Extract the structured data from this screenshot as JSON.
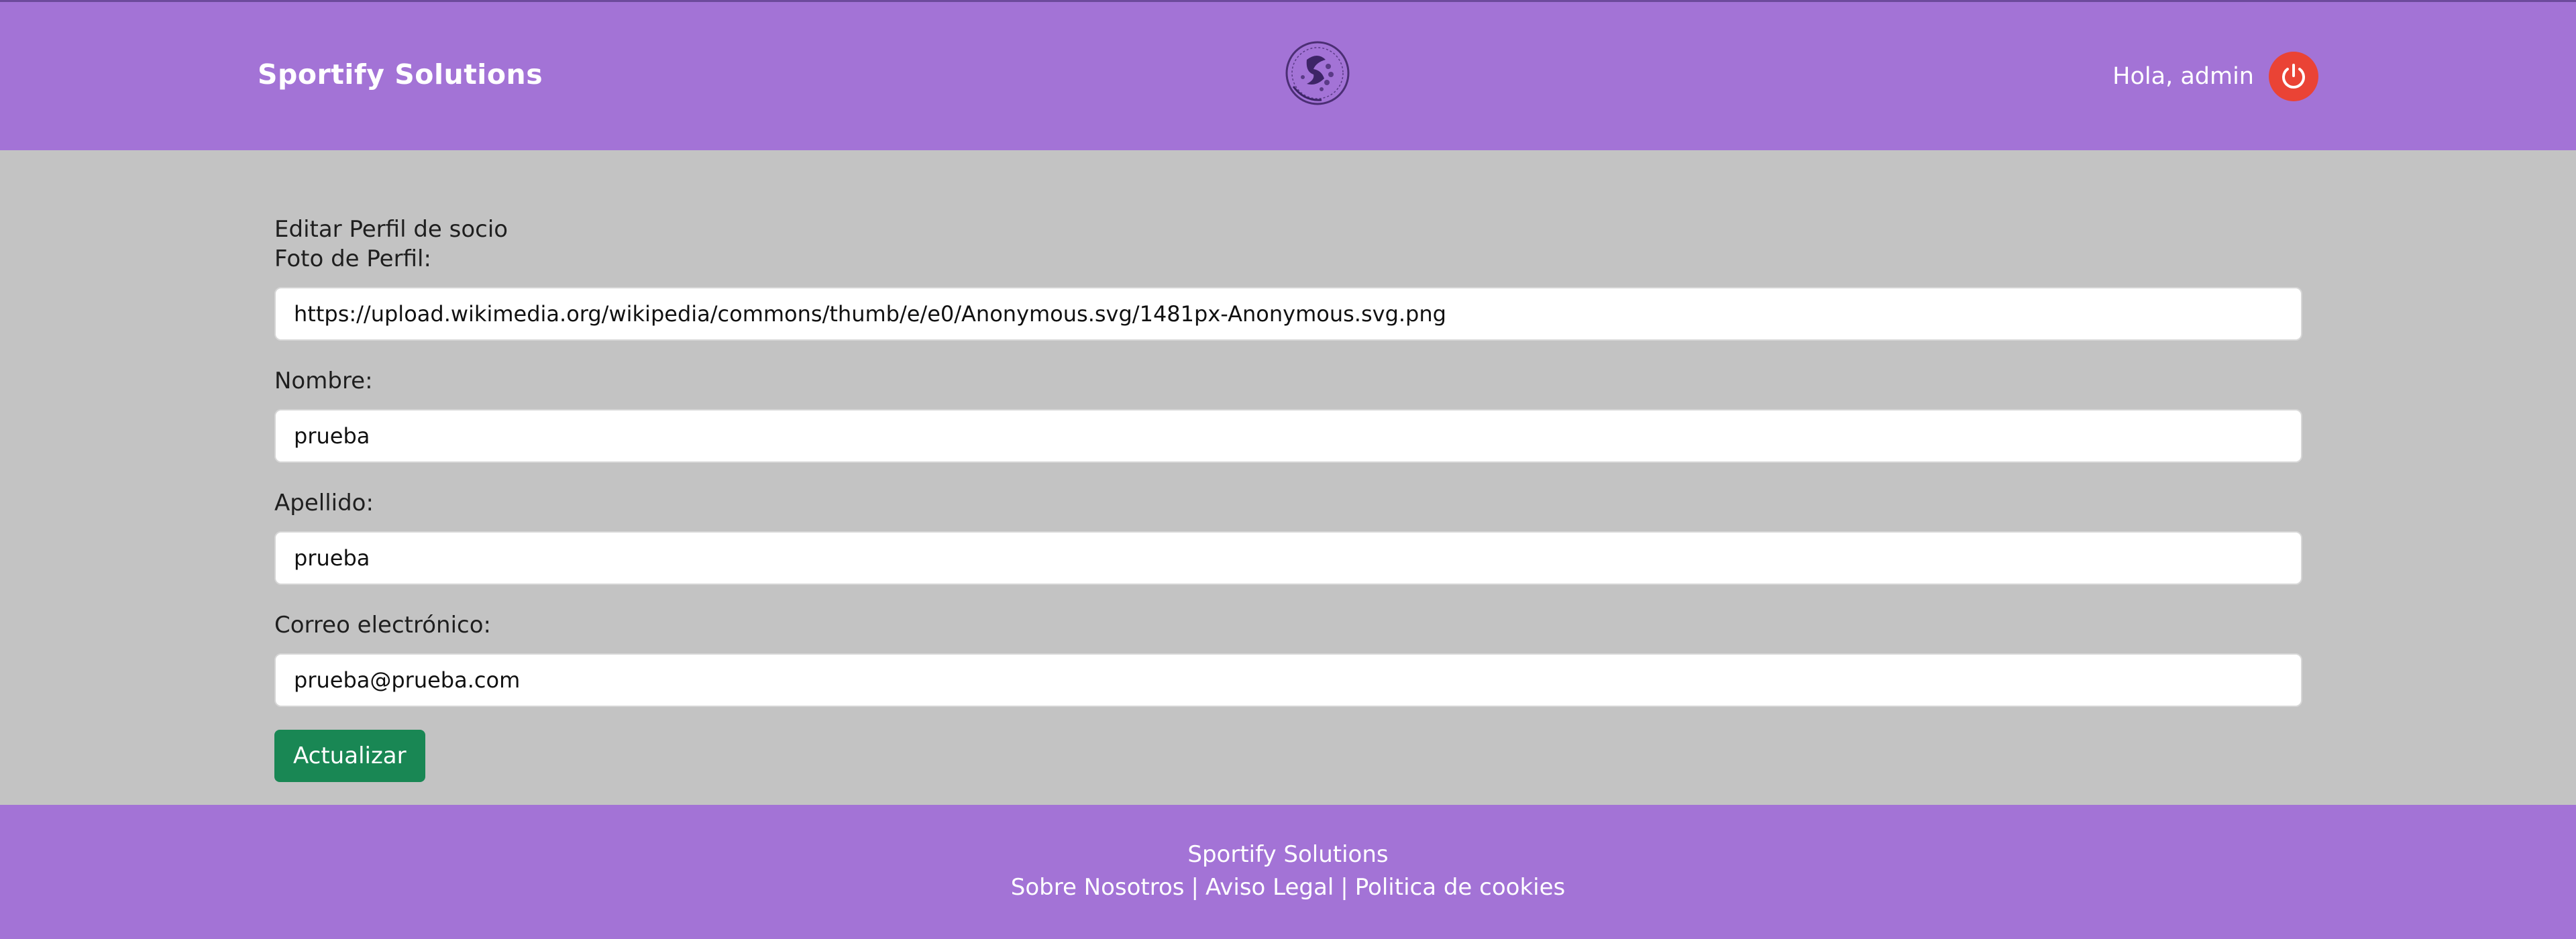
{
  "header": {
    "brand": "Sportify Solutions",
    "greeting": "Hola, admin",
    "logo_icon": "sportify-globe-logo",
    "logout_icon": "power-icon",
    "colors": {
      "bar": "#a373d6",
      "logout": "#ea4335"
    }
  },
  "form": {
    "title": "Editar Perfil de socio",
    "photo_label": "Foto de Perfil:",
    "photo_value": "https://upload.wikimedia.org/wikipedia/commons/thumb/e/e0/Anonymous.svg/1481px-Anonymous.svg.png",
    "name_label": "Nombre:",
    "name_value": "prueba",
    "surname_label": "Apellido:",
    "surname_value": "prueba",
    "email_label": "Correo electrónico:",
    "email_value": "prueba@prueba.com",
    "submit_label": "Actualizar",
    "submit_color": "#198754"
  },
  "footer": {
    "brand": "Sportify Solutions",
    "links": [
      "Sobre Nosotros",
      "Aviso Legal",
      "Politica de cookies"
    ],
    "separator": "|"
  }
}
